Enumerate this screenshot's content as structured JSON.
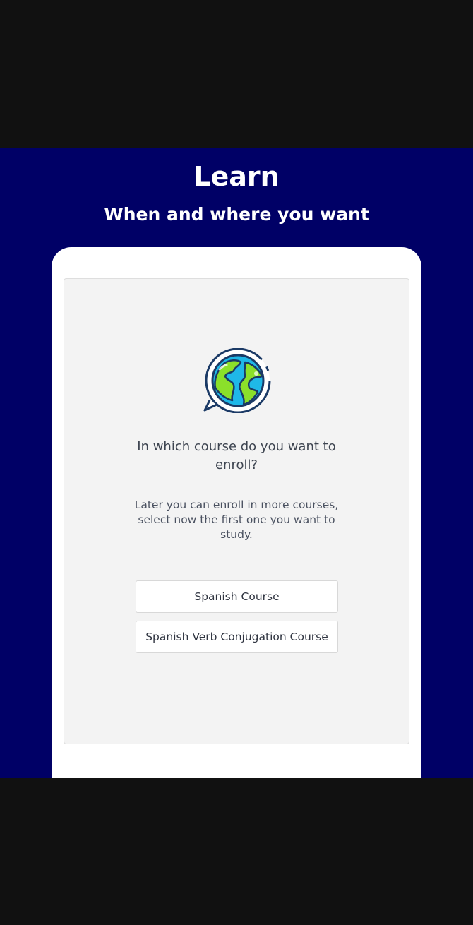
{
  "hero": {
    "title": "Learn",
    "subtitle": "When and where you want"
  },
  "enroll": {
    "icon": "globe-speech-bubble-icon",
    "question": "In which course do you want to enroll?",
    "description": "Later you can enroll in more courses, select now the first one you want to study.",
    "courses": [
      {
        "label": "Spanish Course"
      },
      {
        "label": "Spanish Verb Conjugation Course"
      }
    ]
  },
  "colors": {
    "hero_background": "#000066",
    "letterbox": "#111111",
    "globe_ocean": "#1fb8e8",
    "globe_land": "#8be02a",
    "outline": "#1b3a66"
  }
}
